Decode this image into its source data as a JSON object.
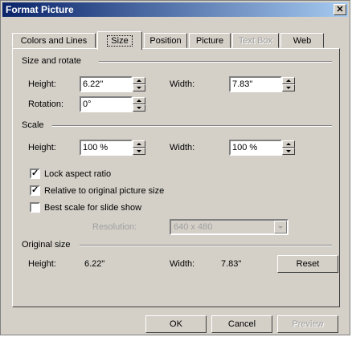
{
  "window": {
    "title": "Format Picture",
    "close_glyph": "✕"
  },
  "tabs": [
    {
      "label": "Colors and Lines",
      "state": "normal"
    },
    {
      "label": "Size",
      "state": "active"
    },
    {
      "label": "Position",
      "state": "normal"
    },
    {
      "label": "Picture",
      "state": "normal"
    },
    {
      "label": "Text Box",
      "state": "disabled"
    },
    {
      "label": "Web",
      "state": "normal"
    }
  ],
  "size_rotate": {
    "section_label": "Size and rotate",
    "height_label": "Height:",
    "height_value": "6.22\"",
    "width_label": "Width:",
    "width_value": "7.83\"",
    "rotation_label": "Rotation:",
    "rotation_value": "0°"
  },
  "scale": {
    "section_label": "Scale",
    "height_label": "Height:",
    "height_value": "100 %",
    "width_label": "Width:",
    "width_value": "100 %",
    "lock_aspect": {
      "label": "Lock aspect ratio",
      "checked": true
    },
    "relative_original": {
      "label": "Relative to original picture size",
      "checked": true
    },
    "best_scale": {
      "label": "Best scale for slide show",
      "checked": false
    },
    "resolution_label": "Resolution:",
    "resolution_value": "640 x 480"
  },
  "original_size": {
    "section_label": "Original size",
    "height_label": "Height:",
    "height_value": "6.22\"",
    "width_label": "Width:",
    "width_value": "7.83\"",
    "reset_label": "Reset"
  },
  "buttons": {
    "ok": "OK",
    "cancel": "Cancel",
    "preview": "Preview"
  },
  "check_glyph": "✓",
  "colors": {
    "dialog_bg": "#d4d0c8",
    "title_start": "#0a246a",
    "title_end": "#a6caf0",
    "disabled_text": "#a0a0a0"
  }
}
